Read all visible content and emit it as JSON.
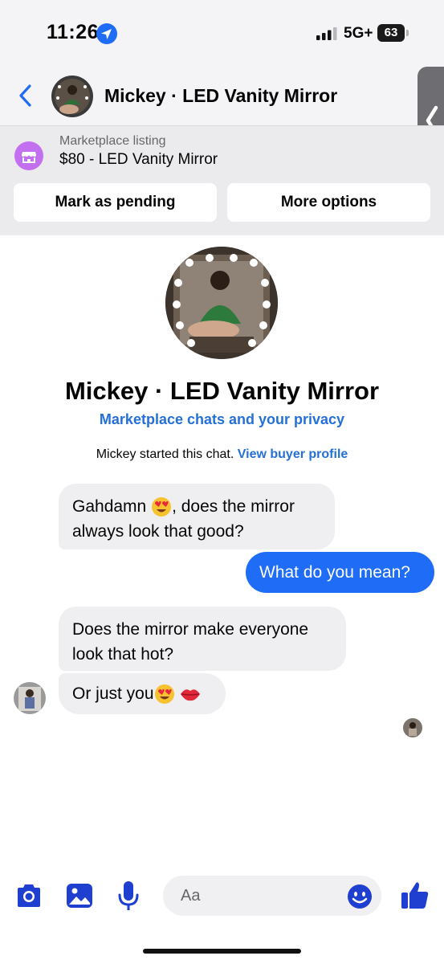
{
  "status_bar": {
    "time": "11:26",
    "network": "5G+",
    "battery": "63"
  },
  "header": {
    "title": "Mickey · LED Vanity Mirror"
  },
  "listing": {
    "caption": "Marketplace listing",
    "title": "$80 - LED Vanity Mirror",
    "mark_pending_label": "Mark as pending",
    "more_options_label": "More options"
  },
  "profile": {
    "name": "Mickey · LED Vanity Mirror",
    "privacy_link": "Marketplace chats and your privacy",
    "started_text": "Mickey started this chat.",
    "view_profile_link": "View buyer profile"
  },
  "messages": [
    {
      "from": "them",
      "text_before": "Gahdamn ",
      "text_after": ", does the mirror always look that good?"
    },
    {
      "from": "me",
      "text": "What do you mean?"
    },
    {
      "from": "them",
      "text": "Does the mirror make everyone look that hot?"
    },
    {
      "from": "them",
      "text_before": "Or just you",
      "text_after": ""
    }
  ],
  "composer": {
    "placeholder": "Aa"
  },
  "colors": {
    "accent": "#1f6cf7",
    "link": "#2470d6",
    "incoming_bubble": "#efeff1",
    "marketplace_icon": "#c26ff0"
  },
  "icons": [
    "location-arrow-icon",
    "signal-icon",
    "battery-icon",
    "back-chevron-icon",
    "expand-handle-icon",
    "marketplace-shop-icon",
    "heart-eyes-emoji-icon",
    "kiss-lips-emoji-icon",
    "camera-icon",
    "gallery-icon",
    "microphone-icon",
    "emoji-icon",
    "thumbs-up-icon"
  ]
}
